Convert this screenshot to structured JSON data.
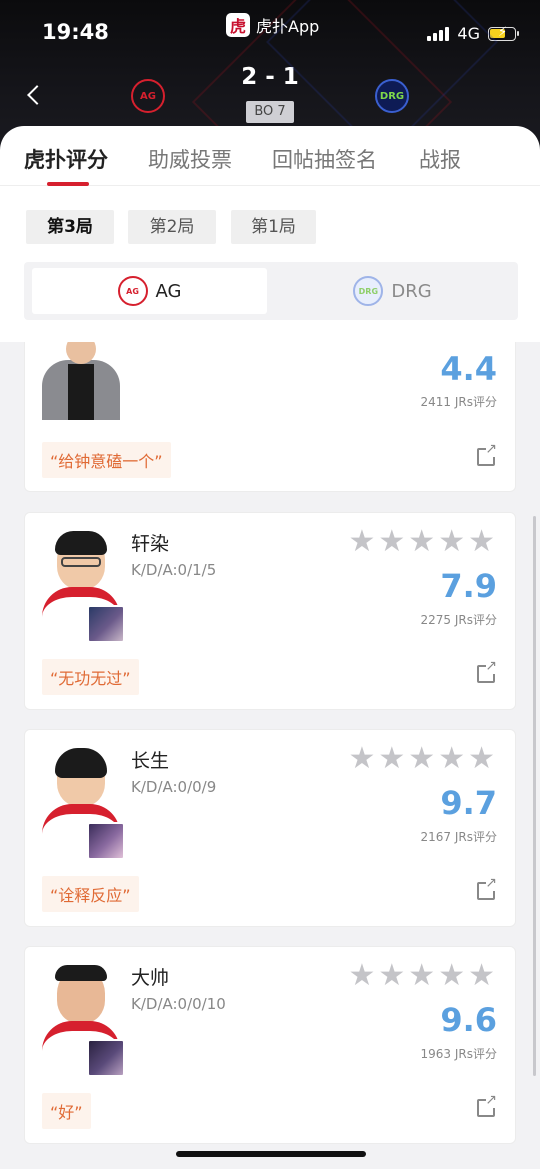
{
  "status_bar": {
    "time": "19:48",
    "network": "4G",
    "app_name": "虎扑App",
    "app_logo_char": "虎"
  },
  "match": {
    "score": "2 - 1",
    "format": "BO 7",
    "team_a_logo_text": "AG",
    "team_b_logo_text": "DRG"
  },
  "tabs": [
    {
      "label": "虎扑评分",
      "active": true
    },
    {
      "label": "助威投票",
      "active": false
    },
    {
      "label": "回帖抽签名",
      "active": false
    },
    {
      "label": "战报",
      "active": false
    }
  ],
  "games": [
    {
      "label": "第3局",
      "active": true
    },
    {
      "label": "第2局",
      "active": false
    },
    {
      "label": "第1局",
      "active": false
    }
  ],
  "teams": [
    {
      "name": "AG",
      "active": true
    },
    {
      "name": "DRG",
      "active": false
    }
  ],
  "players": [
    {
      "name": "",
      "kda": "",
      "rating": "4.4",
      "votes": "2411 JRs评分",
      "comment": "“给钟意磕一个”"
    },
    {
      "name": "轩染",
      "kda": "K/D/A:0/1/5",
      "rating": "7.9",
      "votes": "2275 JRs评分",
      "comment": "“无功无过”",
      "stars_filled": 0
    },
    {
      "name": "长生",
      "kda": "K/D/A:0/0/9",
      "rating": "9.7",
      "votes": "2167 JRs评分",
      "comment": "“诠释反应”",
      "stars_filled": 0
    },
    {
      "name": "大帅",
      "kda": "K/D/A:0/0/10",
      "rating": "9.6",
      "votes": "1963 JRs评分",
      "comment": "“好”",
      "stars_filled": 0
    }
  ],
  "colors": {
    "accent_red": "#d6202e",
    "rating_blue": "#5ba0df",
    "comment_orange": "#e06a35"
  }
}
